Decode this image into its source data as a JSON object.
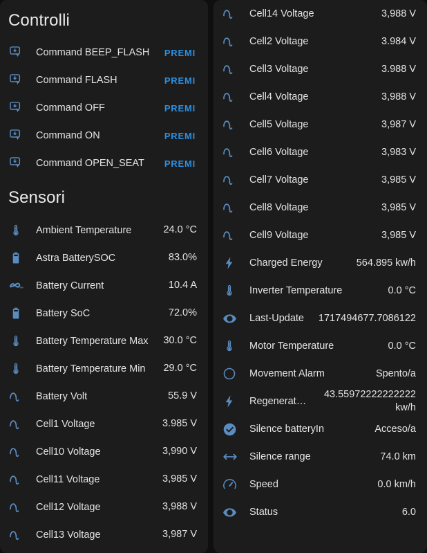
{
  "theme": {
    "background": "#0f0f0f",
    "card_background": "#1c1c1c",
    "text_primary": "#e3e3e3",
    "accent": "#2b8fe0",
    "icon_color": "#5a8cc0"
  },
  "left_card": {
    "controls": {
      "title": "Controlli",
      "items": [
        {
          "icon": "gesture-tap-button-icon",
          "label": "Command BEEP_FLASH",
          "action": "PREMI"
        },
        {
          "icon": "gesture-tap-button-icon",
          "label": "Command FLASH",
          "action": "PREMI"
        },
        {
          "icon": "gesture-tap-button-icon",
          "label": "Command OFF",
          "action": "PREMI"
        },
        {
          "icon": "gesture-tap-button-icon",
          "label": "Command ON",
          "action": "PREMI"
        },
        {
          "icon": "gesture-tap-button-icon",
          "label": "Command OPEN_SEAT",
          "action": "PREMI"
        }
      ]
    },
    "sensors": {
      "title": "Sensori",
      "items": [
        {
          "icon": "thermometer-icon",
          "label": "Ambient Temperature",
          "value": "24.0 °C"
        },
        {
          "icon": "battery-icon",
          "label": "Astra BatterySOC",
          "value": "83.0%"
        },
        {
          "icon": "current-ac-icon",
          "label": "Battery Current",
          "value": "10.4 A"
        },
        {
          "icon": "battery-icon",
          "label": "Battery SoC",
          "value": "72.0%"
        },
        {
          "icon": "thermometer-icon",
          "label": "Battery Temperature Max",
          "value": "30.0 °C"
        },
        {
          "icon": "thermometer-icon",
          "label": "Battery Temperature Min",
          "value": "29.0 °C"
        },
        {
          "icon": "sine-wave-icon",
          "label": "Battery Volt",
          "value": "55.9 V"
        },
        {
          "icon": "sine-wave-icon",
          "label": "Cell1 Voltage",
          "value": "3.985 V"
        },
        {
          "icon": "sine-wave-icon",
          "label": "Cell10 Voltage",
          "value": "3,990 V"
        },
        {
          "icon": "sine-wave-icon",
          "label": "Cell11 Voltage",
          "value": "3,985 V"
        },
        {
          "icon": "sine-wave-icon",
          "label": "Cell12 Voltage",
          "value": "3,988 V"
        },
        {
          "icon": "sine-wave-icon",
          "label": "Cell13 Voltage",
          "value": "3,987 V"
        }
      ]
    }
  },
  "right_card": {
    "sensors": {
      "items": [
        {
          "icon": "sine-wave-icon",
          "label": "Cell14 Voltage",
          "value": "3,988 V"
        },
        {
          "icon": "sine-wave-icon",
          "label": "Cell2 Voltage",
          "value": "3.984 V"
        },
        {
          "icon": "sine-wave-icon",
          "label": "Cell3 Voltage",
          "value": "3.988 V"
        },
        {
          "icon": "sine-wave-icon",
          "label": "Cell4 Voltage",
          "value": "3,988 V"
        },
        {
          "icon": "sine-wave-icon",
          "label": "Cell5 Voltage",
          "value": "3,987 V"
        },
        {
          "icon": "sine-wave-icon",
          "label": "Cell6 Voltage",
          "value": "3,983 V"
        },
        {
          "icon": "sine-wave-icon",
          "label": "Cell7 Voltage",
          "value": "3,985 V"
        },
        {
          "icon": "sine-wave-icon",
          "label": "Cell8 Voltage",
          "value": "3,985 V"
        },
        {
          "icon": "sine-wave-icon",
          "label": "Cell9 Voltage",
          "value": "3,985 V"
        },
        {
          "icon": "flash-icon",
          "label": "Charged Energy",
          "value": "564.895 kw/h"
        },
        {
          "icon": "thermometer-icon",
          "label": "Inverter Temperature",
          "value": "0.0 °C"
        },
        {
          "icon": "eye-icon",
          "label": "Last-Update",
          "value": "1717494677.7086122"
        },
        {
          "icon": "thermometer-icon",
          "label": "Motor Temperature",
          "value": "0.0 °C"
        },
        {
          "icon": "circle-outline-icon",
          "label": "Movement Alarm",
          "value": "Spento/a"
        },
        {
          "icon": "flash-icon",
          "label": "Regenerat…",
          "value": "43.55972222222222 kw/h"
        },
        {
          "icon": "check-circle-icon",
          "label": "Silence batteryIn",
          "value": "Acceso/a"
        },
        {
          "icon": "arrow-left-right-icon",
          "label": "Silence range",
          "value": "74.0 km"
        },
        {
          "icon": "speedometer-icon",
          "label": "Speed",
          "value": "0.0 km/h"
        },
        {
          "icon": "eye-icon",
          "label": "Status",
          "value": "6.0"
        }
      ]
    }
  }
}
